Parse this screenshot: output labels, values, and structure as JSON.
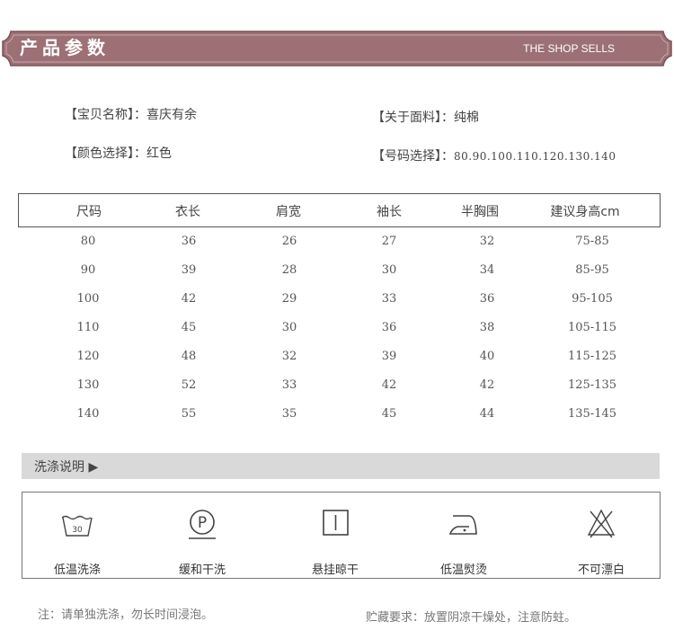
{
  "header": {
    "title": "产品参数",
    "subtitle": "THE SHOP SELLS",
    "color": "#9c7075"
  },
  "info": {
    "name_label": "【宝贝名称】：",
    "name_value": "喜庆有余",
    "color_label": "【颜色选择】：",
    "color_value": "红色",
    "fabric_label": "【关于面料】：",
    "fabric_value": "纯棉",
    "size_label": "【号码选择】：",
    "size_value": "80.90.100.110.120.130.140"
  },
  "size_table": {
    "headers": [
      "尺码",
      "衣长",
      "肩宽",
      "袖长",
      "半胸围",
      "建议身高cm"
    ],
    "rows": [
      [
        "80",
        "36",
        "26",
        "27",
        "32",
        "75-85"
      ],
      [
        "90",
        "39",
        "28",
        "30",
        "34",
        "85-95"
      ],
      [
        "100",
        "42",
        "29",
        "33",
        "36",
        "95-105"
      ],
      [
        "110",
        "45",
        "30",
        "36",
        "38",
        "105-115"
      ],
      [
        "120",
        "48",
        "32",
        "39",
        "40",
        "115-125"
      ],
      [
        "130",
        "52",
        "33",
        "42",
        "42",
        "125-135"
      ],
      [
        "140",
        "55",
        "35",
        "45",
        "44",
        "135-145"
      ]
    ]
  },
  "wash": {
    "title": "洗涤说明 ▶",
    "items": [
      {
        "icon": "wash-30-icon",
        "label": "低温洗涤",
        "badge": "30"
      },
      {
        "icon": "dry-clean-p-icon",
        "label": "缓和干洗",
        "badge": "P"
      },
      {
        "icon": "hang-dry-icon",
        "label": "悬挂晾干"
      },
      {
        "icon": "iron-low-icon",
        "label": "低温熨烫"
      },
      {
        "icon": "no-bleach-icon",
        "label": "不可漂白"
      }
    ]
  },
  "notes": {
    "left": "注：请单独洗涤，勿长时间浸泡。",
    "right": "贮藏要求：放置阴凉干燥处，注意防蛀。"
  }
}
